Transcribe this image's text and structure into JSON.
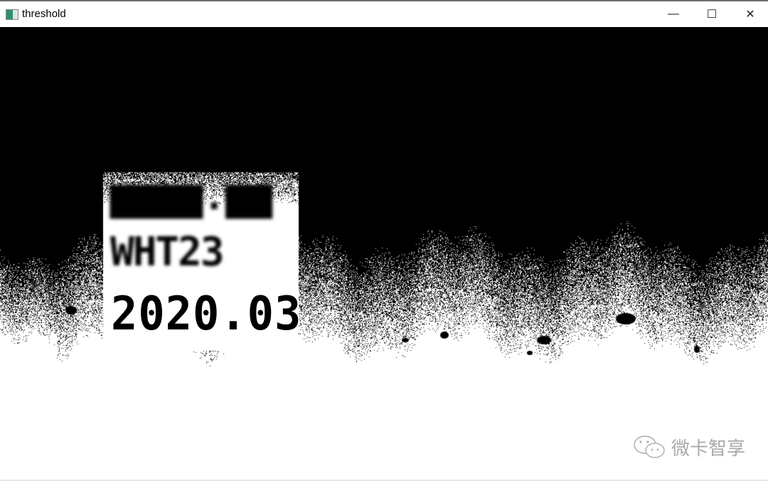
{
  "window": {
    "title": "threshold",
    "icon": "opencv-window-icon",
    "controls": {
      "minimize": "—",
      "maximize": "☐",
      "close": "✕"
    }
  },
  "image": {
    "lines": [
      "",
      "WHT23",
      "2020.03"
    ],
    "watermark": "微卡智享",
    "watermark_icon": "wechat-icon",
    "colors": {
      "foreground": "#000000",
      "background": "#ffffff"
    }
  }
}
